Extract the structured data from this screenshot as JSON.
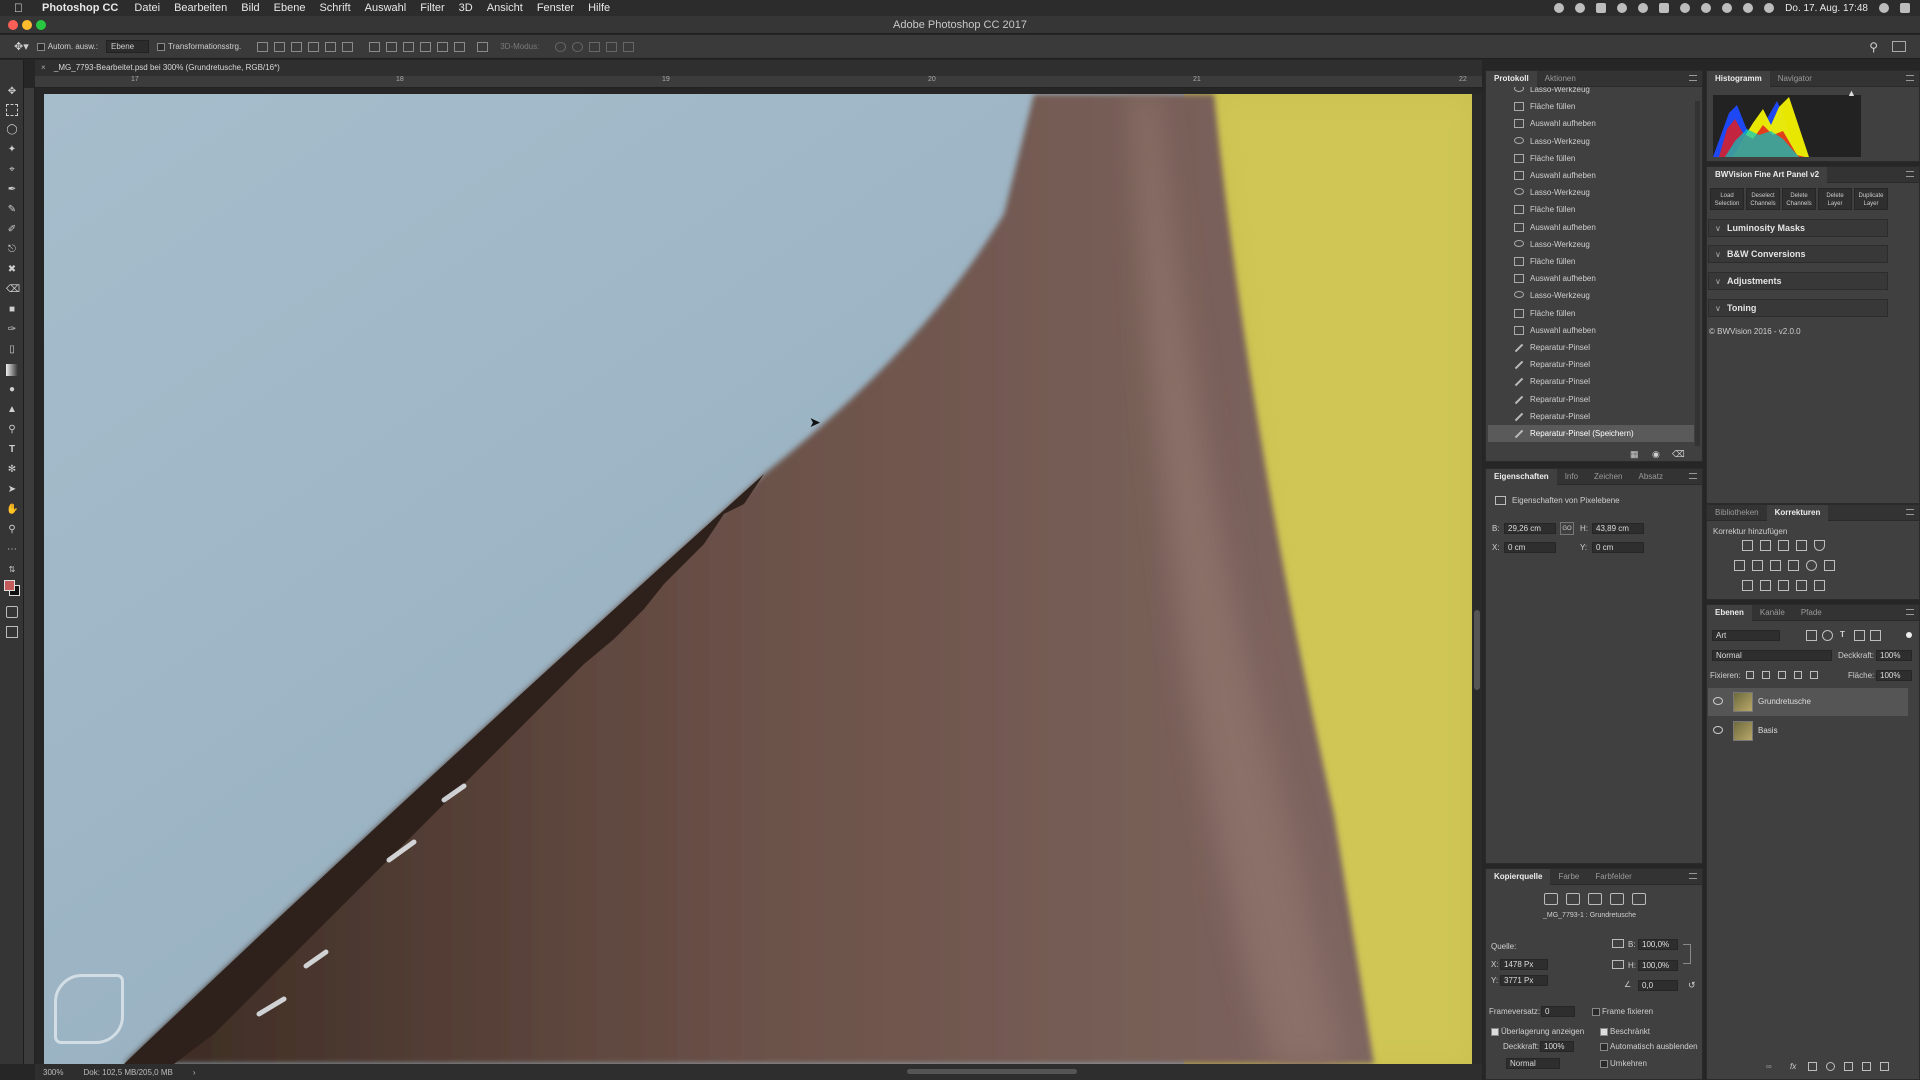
{
  "menubar": {
    "app_name": "Photoshop CC",
    "items": [
      "Datei",
      "Bearbeiten",
      "Bild",
      "Ebene",
      "Schrift",
      "Auswahl",
      "Filter",
      "3D",
      "Ansicht",
      "Fenster",
      "Hilfe"
    ],
    "clock": "Do. 17. Aug.  17:48"
  },
  "window": {
    "title": "Adobe Photoshop CC 2017"
  },
  "options_bar": {
    "auto_select_label": "Autom. ausw.:",
    "auto_select_value": "Ebene",
    "transform_label": "Transformationsstrg.",
    "mode_3d_label": "3D-Modus:"
  },
  "document": {
    "tab_title": "_MG_7793-Bearbeitet.psd bei 300% (Grundretusche, RGB/16*)",
    "ruler_ticks": [
      "17",
      "18",
      "19",
      "20",
      "21",
      "22"
    ]
  },
  "status": {
    "zoom": "300%",
    "doc_size": "Dok: 102,5 MB/205,0 MB"
  },
  "history_panel": {
    "tabs": [
      "Protokoll",
      "Aktionen"
    ],
    "active_tab": "Protokoll",
    "items": [
      {
        "label": "Lasso-Werkzeug",
        "icon": "lasso-icon"
      },
      {
        "label": "Fläche füllen",
        "icon": "fill-icon"
      },
      {
        "label": "Auswahl aufheben",
        "icon": "deselect-icon"
      },
      {
        "label": "Lasso-Werkzeug",
        "icon": "lasso-icon"
      },
      {
        "label": "Fläche füllen",
        "icon": "fill-icon"
      },
      {
        "label": "Auswahl aufheben",
        "icon": "deselect-icon"
      },
      {
        "label": "Lasso-Werkzeug",
        "icon": "lasso-icon"
      },
      {
        "label": "Fläche füllen",
        "icon": "fill-icon"
      },
      {
        "label": "Auswahl aufheben",
        "icon": "deselect-icon"
      },
      {
        "label": "Lasso-Werkzeug",
        "icon": "lasso-icon"
      },
      {
        "label": "Fläche füllen",
        "icon": "fill-icon"
      },
      {
        "label": "Auswahl aufheben",
        "icon": "deselect-icon"
      },
      {
        "label": "Lasso-Werkzeug",
        "icon": "lasso-icon"
      },
      {
        "label": "Fläche füllen",
        "icon": "fill-icon"
      },
      {
        "label": "Auswahl aufheben",
        "icon": "deselect-icon"
      },
      {
        "label": "Reparatur-Pinsel",
        "icon": "healing-brush-icon"
      },
      {
        "label": "Reparatur-Pinsel",
        "icon": "healing-brush-icon"
      },
      {
        "label": "Reparatur-Pinsel",
        "icon": "healing-brush-icon"
      },
      {
        "label": "Reparatur-Pinsel",
        "icon": "healing-brush-icon"
      },
      {
        "label": "Reparatur-Pinsel",
        "icon": "healing-brush-icon"
      },
      {
        "label": "Reparatur-Pinsel (Speichern)",
        "icon": "healing-brush-icon",
        "selected": true
      }
    ]
  },
  "properties_panel": {
    "tabs": [
      "Eigenschaften",
      "Info",
      "Zeichen",
      "Absatz"
    ],
    "active_tab": "Eigenschaften",
    "heading": "Eigenschaften von Pixelebene",
    "w_label": "B:",
    "w_value": "29,26 cm",
    "h_label": "H:",
    "h_value": "43,89 cm",
    "x_label": "X:",
    "x_value": "0 cm",
    "y_label": "Y:",
    "y_value": "0 cm",
    "link_label": "GO"
  },
  "clone_source_panel": {
    "tabs": [
      "Kopierquelle",
      "Farbe",
      "Farbfelder"
    ],
    "active_tab": "Kopierquelle",
    "source_name": "_MG_7793-1 : Grundretusche",
    "source_label": "Quelle:",
    "x_label": "X:",
    "x_value": "1478 Px",
    "y_label": "Y:",
    "y_value": "3771 Px",
    "w_label": "B:",
    "w_value": "100,0%",
    "h_label": "H:",
    "h_value": "100,0%",
    "angle_value": "0,0",
    "frame_offset_label": "Frameversatz:",
    "frame_offset_value": "0",
    "lock_frame_label": "Frame fixieren",
    "show_overlay_label": "Überlagerung anzeigen",
    "clipped_label": "Beschränkt",
    "opacity_label": "Deckkraft:",
    "opacity_value": "100%",
    "auto_hide_label": "Automatisch ausblenden",
    "blend_value": "Normal",
    "invert_label": "Umkehren"
  },
  "histogram_panel": {
    "tabs": [
      "Histogramm",
      "Navigator"
    ],
    "active_tab": "Histogramm"
  },
  "bwvision_panel": {
    "title": "BWVision Fine Art Panel v2",
    "buttons": [
      "Load Selection",
      "Deselect Channels",
      "Delete Channels",
      "Delete Layer",
      "Duplicate Layer"
    ],
    "sections": [
      "Luminosity Masks",
      "B&W Conversions",
      "Adjustments",
      "Toning"
    ],
    "footer": "© BWVision 2016 - v2.0.0"
  },
  "adjustments_panel": {
    "tabs": [
      "Bibliotheken",
      "Korrekturen"
    ],
    "active_tab": "Korrekturen",
    "heading": "Korrektur hinzufügen"
  },
  "layers_panel": {
    "tabs": [
      "Ebenen",
      "Kanäle",
      "Pfade"
    ],
    "active_tab": "Ebenen",
    "filter_value": "Art",
    "blend_mode": "Normal",
    "opacity_label": "Deckkraft:",
    "opacity_value": "100%",
    "lock_label": "Fixieren:",
    "fill_label": "Fläche:",
    "fill_value": "100%",
    "layers": [
      {
        "name": "Grundretusche",
        "selected": true
      },
      {
        "name": "Basis",
        "selected": false
      }
    ]
  }
}
